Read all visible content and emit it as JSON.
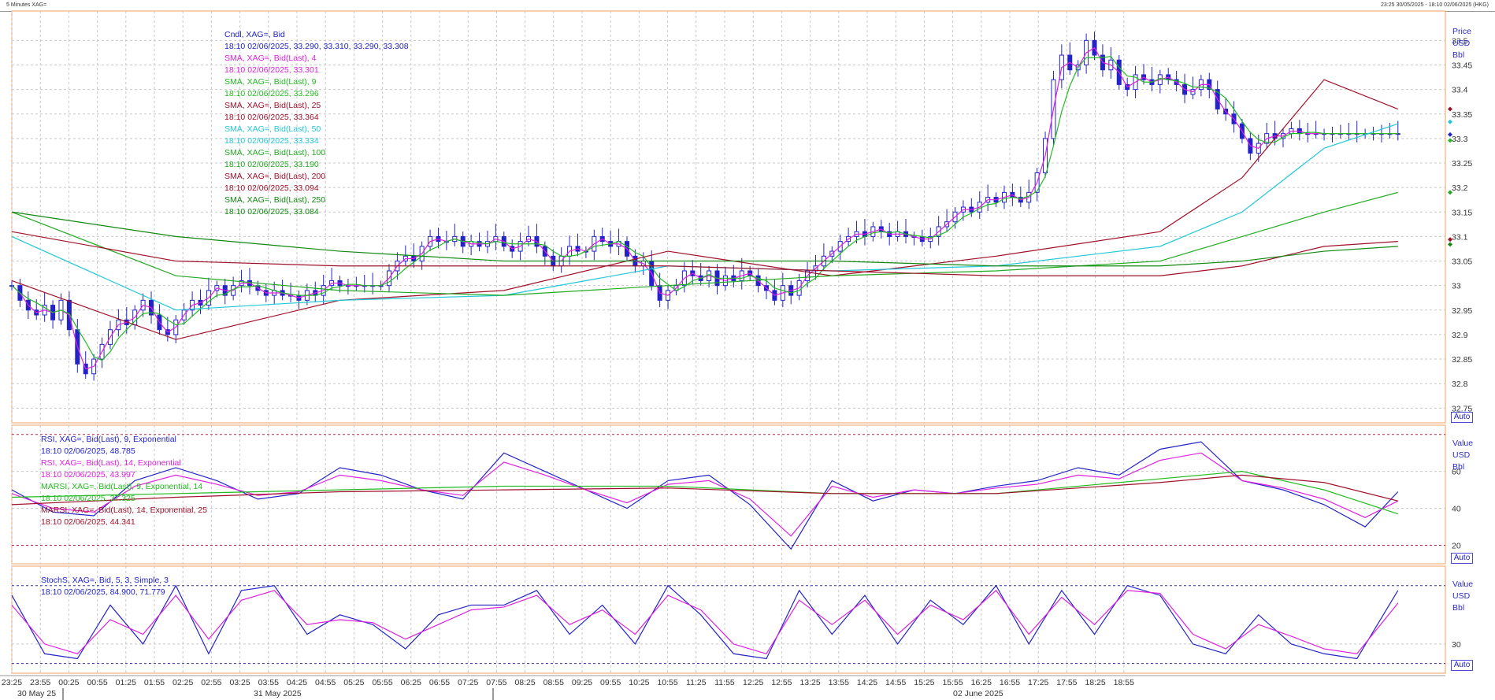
{
  "window": {
    "title": "5 Minutes XAG=",
    "range": "23:25 30/05/2025 - 18:10 02/06/2025 (HKG)"
  },
  "price_panel": {
    "legend": [
      {
        "title": "Cndl, XAG=, Bid",
        "value": "18:10 02/06/2025, 33.290, 33.310, 33.290, 33.308",
        "color": "#2323c8"
      },
      {
        "title": "SMA, XAG=, Bid(Last),  4",
        "value": "18:10 02/06/2025, 33.301",
        "color": "#e020e0"
      },
      {
        "title": "SMA, XAG=, Bid(Last),  9",
        "value": "18:10 02/06/2025, 33.296",
        "color": "#22bb22"
      },
      {
        "title": "SMA, XAG=, Bid(Last),  25",
        "value": "18:10 02/06/2025, 33.364",
        "color": "#a0102a"
      },
      {
        "title": "SMA, XAG=, Bid(Last),  50",
        "value": "18:10 02/06/2025, 33.334",
        "color": "#20c8d8"
      },
      {
        "title": "SMA, XAG=, Bid(Last),  100",
        "value": "18:10 02/06/2025, 33.190",
        "color": "#22aa22"
      },
      {
        "title": "SMA, XAG=, Bid(Last),  200",
        "value": "18:10 02/06/2025, 33.094",
        "color": "#a0102a"
      },
      {
        "title": "SMA, XAG=, Bid(Last),  250",
        "value": "18:10 02/06/2025, 33.084",
        "color": "#118811"
      }
    ],
    "unit_labels": [
      "Price",
      "USD",
      "Bbl"
    ],
    "auto_label": "Auto"
  },
  "rsi_panel": {
    "legend": [
      {
        "title": "RSI, XAG=, Bid(Last),  9, Exponential",
        "value": "18:10 02/06/2025, 48.785",
        "color": "#2323c8"
      },
      {
        "title": "RSI, XAG=, Bid(Last),  14, Exponential",
        "value": "18:10 02/06/2025, 43.997",
        "color": "#e020e0"
      },
      {
        "title": "MARSI, XAG=, Bid(Last),  9, Exponential, 14",
        "value": "18:10 02/06/2025, 37.325",
        "color": "#22bb22"
      },
      {
        "title": "MARSI, XAG=, Bid(Last),  14, Exponential, 25",
        "value": "18:10 02/06/2025, 44.341",
        "color": "#a0102a"
      }
    ],
    "unit_labels": [
      "Value",
      "USD",
      "Bbl"
    ],
    "auto_label": "Auto"
  },
  "stoch_panel": {
    "legend": [
      {
        "title": "StochS, XAG=, Bid,  5, 3, Simple, 3",
        "value": "18:10 02/06/2025, 84.900, 71.779",
        "color": "#2323c8"
      }
    ],
    "unit_labels": [
      "Value",
      "USD",
      "Bbl"
    ],
    "auto_label": "Auto"
  },
  "colors": {
    "candle": "#2323c8",
    "sma4": "#e020e0",
    "sma9": "#22bb22",
    "sma25": "#a0102a",
    "sma50": "#20c8d8",
    "sma100": "#22aa22",
    "sma200": "#a0102a",
    "sma250": "#118811",
    "rsi9": "#2323c8",
    "rsi14": "#e020e0",
    "marsi9": "#22bb22",
    "marsi14": "#a0102a",
    "stoch_k": "#2323c8",
    "stoch_d": "#e020e0",
    "grid": "#c8c8c8",
    "panel_border": "#f0a060"
  },
  "chart_data": [
    {
      "type": "line",
      "title": "Cndl, XAG=, Bid",
      "x_ticks": [
        "23:25",
        "23:55",
        "00:25",
        "00:55",
        "01:25",
        "01:55",
        "02:25",
        "02:55",
        "03:25",
        "03:55",
        "04:25",
        "04:55",
        "05:25",
        "05:55",
        "06:25",
        "06:55",
        "07:25",
        "07:55",
        "08:25",
        "08:55",
        "09:25",
        "09:55",
        "10:25",
        "10:55",
        "11:25",
        "11:55",
        "12:25",
        "12:55",
        "13:25",
        "13:55",
        "14:25",
        "14:55",
        "15:25",
        "15:55",
        "16:25",
        "16:55",
        "17:25",
        "17:55",
        "18:25",
        "18:55"
      ],
      "date_labels": [
        "30 May 25",
        "31 May 2025",
        "02 June 2025"
      ],
      "y_ticks": [
        "33.5",
        "33.45",
        "33.4",
        "33.35",
        "33.3",
        "33.25",
        "33.2",
        "33.15",
        "33.1",
        "33.05",
        "33",
        "32.95",
        "32.9",
        "32.85",
        "32.8",
        "32.75"
      ],
      "ylim": [
        32.72,
        33.56
      ],
      "grid": true,
      "series": [
        {
          "name": "Cndl, XAG=, Bid",
          "x": [
            0,
            2,
            4,
            6,
            8,
            10,
            12,
            14,
            16,
            18,
            20,
            22,
            24,
            26,
            28,
            30,
            32,
            34,
            36,
            38,
            40,
            42,
            44,
            46,
            48,
            50,
            52,
            54,
            56,
            58,
            60,
            62,
            64,
            66,
            68,
            70,
            72,
            74,
            76,
            78,
            80,
            82,
            84,
            86,
            88,
            90,
            92,
            94,
            96,
            98,
            100,
            102,
            104,
            106,
            108,
            110,
            112,
            114,
            116,
            118,
            120,
            122,
            124,
            126,
            128,
            130,
            132,
            134,
            136,
            138,
            140,
            142,
            144,
            146,
            148,
            150,
            152,
            154,
            156,
            158,
            160,
            162,
            164,
            166,
            168,
            170,
            172,
            174,
            176,
            178,
            180,
            182,
            184,
            186,
            188,
            190,
            192,
            194,
            196,
            198,
            200,
            202,
            204,
            206,
            208,
            210,
            212,
            214,
            216,
            218,
            220,
            222,
            224,
            226,
            228,
            230,
            232,
            234,
            236,
            238,
            240,
            242,
            244,
            246,
            248,
            250,
            252,
            254,
            256,
            258,
            260,
            262,
            264,
            266,
            268,
            270,
            272,
            274,
            276,
            278,
            280,
            282,
            284,
            286,
            288,
            290,
            292,
            294,
            296,
            298,
            300,
            302,
            304,
            306,
            308,
            310,
            312,
            314,
            316,
            318,
            320,
            322,
            324,
            326,
            328,
            330,
            332,
            334,
            336,
            338
          ],
          "y": [
            33.0,
            32.97,
            32.95,
            32.94,
            32.96,
            32.93,
            32.97,
            32.91,
            32.84,
            32.82,
            32.85,
            32.88,
            32.91,
            32.93,
            32.92,
            32.95,
            32.97,
            32.94,
            32.91,
            32.9,
            32.93,
            32.95,
            32.97,
            32.96,
            32.99,
            33.0,
            32.98,
            33.0,
            33.01,
            33.0,
            32.99,
            32.98,
            32.99,
            32.98,
            32.98,
            32.97,
            32.99,
            32.98,
            33.0,
            33.01,
            33.0,
            33.0,
            33.0,
            33.0,
            33.0,
            33.0,
            33.03,
            33.05,
            33.06,
            33.05,
            33.08,
            33.1,
            33.09,
            33.09,
            33.1,
            33.08,
            33.09,
            33.08,
            33.09,
            33.1,
            33.08,
            33.07,
            33.09,
            33.1,
            33.08,
            33.06,
            33.04,
            33.06,
            33.08,
            33.07,
            33.07,
            33.1,
            33.09,
            33.08,
            33.09,
            33.06,
            33.04,
            33.05,
            33.0,
            32.97,
            32.99,
            33.0,
            33.03,
            33.02,
            33.01,
            33.03,
            33.0,
            33.02,
            33.01,
            33.03,
            33.02,
            33.0,
            32.99,
            32.97,
            33.0,
            32.98,
            33.01,
            33.03,
            33.04,
            33.06,
            33.07,
            33.09,
            33.1,
            33.11,
            33.1,
            33.12,
            33.11,
            33.1,
            33.11,
            33.1,
            33.1,
            33.09,
            33.1,
            33.12,
            33.13,
            33.15,
            33.16,
            33.15,
            33.17,
            33.18,
            33.17,
            33.19,
            33.18,
            33.17,
            33.19,
            33.23,
            33.3,
            33.42,
            33.47,
            33.44,
            33.45,
            33.5,
            33.47,
            33.44,
            33.46,
            33.41,
            33.4,
            33.43,
            33.42,
            33.41,
            33.43,
            33.42,
            33.41,
            33.39,
            33.4,
            33.42,
            33.4,
            33.36,
            33.35,
            33.33,
            33.3,
            33.27,
            33.29,
            33.31,
            33.3,
            33.31,
            33.32,
            33.31,
            33.31,
            33.31,
            33.31,
            33.31,
            33.31,
            33.31,
            33.31,
            33.31,
            33.31,
            33.31,
            33.31,
            33.31
          ]
        },
        {
          "name": "SMA 25",
          "x": [
            0,
            40,
            80,
            120,
            160,
            200,
            240,
            280,
            300,
            320,
            338
          ],
          "y": [
            33.01,
            32.89,
            32.97,
            32.99,
            33.07,
            33.02,
            33.06,
            33.11,
            33.22,
            33.42,
            33.36
          ]
        },
        {
          "name": "SMA 50",
          "x": [
            0,
            40,
            80,
            120,
            160,
            200,
            240,
            280,
            300,
            320,
            338
          ],
          "y": [
            33.1,
            32.95,
            32.97,
            32.98,
            33.04,
            33.03,
            33.04,
            33.08,
            33.15,
            33.28,
            33.33
          ]
        },
        {
          "name": "SMA 100",
          "x": [
            0,
            40,
            80,
            120,
            160,
            200,
            240,
            280,
            300,
            320,
            338
          ],
          "y": [
            33.15,
            33.02,
            32.99,
            32.98,
            33.0,
            33.02,
            33.03,
            33.05,
            33.1,
            33.15,
            33.19
          ]
        },
        {
          "name": "SMA 200",
          "x": [
            0,
            40,
            80,
            120,
            160,
            200,
            240,
            280,
            300,
            320,
            338
          ],
          "y": [
            33.11,
            33.05,
            33.04,
            33.04,
            33.04,
            33.03,
            33.02,
            33.02,
            33.04,
            33.08,
            33.09
          ]
        },
        {
          "name": "SMA 250",
          "x": [
            0,
            40,
            80,
            120,
            160,
            200,
            240,
            280,
            300,
            320,
            338
          ],
          "y": [
            33.15,
            33.1,
            33.07,
            33.05,
            33.05,
            33.05,
            33.04,
            33.04,
            33.05,
            33.07,
            33.08
          ]
        }
      ]
    },
    {
      "type": "line",
      "title": "RSI, XAG=, Bid(Last),  9, Exponential",
      "y_ticks": [
        "60",
        "40",
        "20"
      ],
      "ylim": [
        10,
        85
      ],
      "series": [
        {
          "name": "RSI 9",
          "x": [
            0,
            10,
            20,
            30,
            40,
            50,
            60,
            70,
            80,
            90,
            100,
            110,
            120,
            130,
            140,
            150,
            160,
            170,
            180,
            190,
            200,
            210,
            220,
            230,
            240,
            250,
            260,
            270,
            280,
            290,
            300,
            310,
            320,
            330,
            338
          ],
          "y": [
            50,
            38,
            36,
            55,
            62,
            55,
            45,
            48,
            62,
            58,
            50,
            45,
            70,
            60,
            50,
            40,
            55,
            58,
            42,
            18,
            55,
            44,
            50,
            48,
            52,
            55,
            62,
            58,
            72,
            76,
            55,
            50,
            42,
            30,
            49
          ]
        },
        {
          "name": "RSI 14",
          "x": [
            0,
            10,
            20,
            30,
            40,
            50,
            60,
            70,
            80,
            90,
            100,
            110,
            120,
            130,
            140,
            150,
            160,
            170,
            180,
            190,
            200,
            210,
            220,
            230,
            240,
            250,
            260,
            270,
            280,
            290,
            300,
            310,
            320,
            330,
            338
          ],
          "y": [
            48,
            40,
            38,
            52,
            58,
            53,
            47,
            49,
            58,
            55,
            50,
            47,
            65,
            58,
            50,
            43,
            53,
            55,
            45,
            25,
            52,
            46,
            50,
            48,
            51,
            53,
            58,
            56,
            66,
            70,
            55,
            51,
            45,
            35,
            44
          ]
        },
        {
          "name": "MARSI 9",
          "x": [
            0,
            40,
            80,
            120,
            160,
            200,
            240,
            280,
            300,
            320,
            338
          ],
          "y": [
            46,
            48,
            50,
            52,
            52,
            48,
            48,
            56,
            60,
            50,
            37
          ]
        },
        {
          "name": "MARSI 14",
          "x": [
            0,
            40,
            80,
            120,
            160,
            200,
            240,
            280,
            300,
            320,
            338
          ],
          "y": [
            42,
            46,
            49,
            50,
            51,
            48,
            48,
            54,
            58,
            54,
            44
          ]
        }
      ]
    },
    {
      "type": "line",
      "title": "StochS, XAG=, Bid,  5, 3, Simple, 3",
      "y_ticks": [
        "30"
      ],
      "ylim": [
        0,
        110
      ],
      "series": [
        {
          "name": "StochS %K",
          "x": [
            0,
            8,
            16,
            24,
            32,
            40,
            48,
            56,
            64,
            72,
            80,
            88,
            96,
            104,
            112,
            120,
            128,
            136,
            144,
            152,
            160,
            168,
            176,
            184,
            192,
            200,
            208,
            216,
            224,
            232,
            240,
            248,
            256,
            264,
            272,
            280,
            288,
            296,
            304,
            312,
            320,
            328,
            338
          ],
          "y": [
            80,
            20,
            15,
            70,
            30,
            90,
            20,
            85,
            90,
            40,
            60,
            50,
            25,
            60,
            70,
            70,
            85,
            40,
            70,
            30,
            90,
            60,
            20,
            15,
            85,
            40,
            80,
            30,
            75,
            50,
            90,
            30,
            85,
            40,
            90,
            80,
            30,
            20,
            60,
            30,
            20,
            15,
            85
          ]
        },
        {
          "name": "StochS %D",
          "x": [
            0,
            8,
            16,
            24,
            32,
            40,
            48,
            56,
            64,
            72,
            80,
            88,
            96,
            104,
            112,
            120,
            128,
            136,
            144,
            152,
            160,
            168,
            176,
            184,
            192,
            200,
            208,
            216,
            224,
            232,
            240,
            248,
            256,
            264,
            272,
            280,
            288,
            296,
            304,
            312,
            320,
            328,
            338
          ],
          "y": [
            70,
            30,
            20,
            55,
            40,
            80,
            35,
            75,
            85,
            50,
            55,
            52,
            35,
            50,
            65,
            68,
            80,
            50,
            65,
            40,
            80,
            65,
            30,
            20,
            75,
            50,
            75,
            40,
            70,
            55,
            85,
            40,
            78,
            50,
            85,
            82,
            40,
            25,
            50,
            38,
            25,
            20,
            72
          ]
        }
      ]
    }
  ]
}
